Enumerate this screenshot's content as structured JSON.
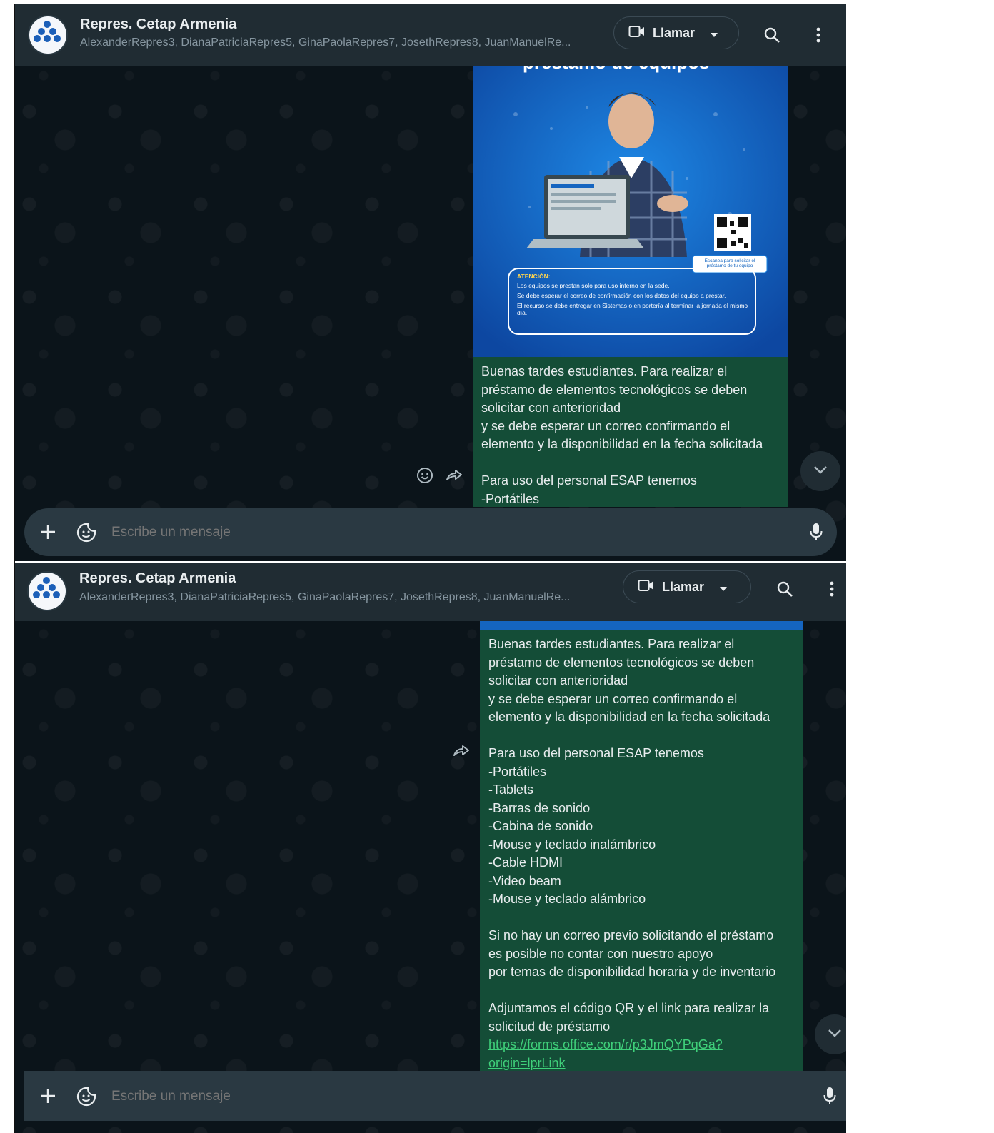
{
  "chat": {
    "title": "Repres. Cetap Armenia",
    "participants": "AlexanderRepres3, DianaPatriciaRepres5, GinaPaolaRepres7, JosethRepres8, JuanManuelRe..."
  },
  "header": {
    "call_label": "Llamar"
  },
  "poster": {
    "heading_fragment": "préstamo de equipos",
    "qr_caption": "Escanea para solicitar el préstamo de tu equipo",
    "attention_title": "ATENCIÓN:",
    "attention_items": [
      "Los equipos se prestan solo para uso interno en la sede.",
      "Se debe esperar el correo de confirmación con los datos del equipo a prestar.",
      "El recurso se debe entregar en Sistemas o en portería al terminar la jornada el mismo día."
    ]
  },
  "message": {
    "lines": [
      "Buenas tardes estudiantes. Para realizar el",
      "préstamo de elementos tecnológicos se deben",
      "solicitar con anterioridad",
      "y se debe esperar un correo confirmando el",
      "elemento y la disponibilidad en la fecha solicitada",
      "",
      "Para uso del personal ESAP tenemos",
      "-Portátiles",
      "-Tablets",
      "-Barras de sonido",
      "-Cabina de sonido",
      "-Mouse y teclado inalámbrico",
      "-Cable HDMI",
      "-Video beam",
      "-Mouse y teclado alámbrico",
      "",
      "Si no hay un correo previo solicitando el préstamo",
      "es posible no contar con nuestro apoyo",
      "por temas de disponibilidad horaria y de inventario",
      "",
      "Adjuntamos el código QR y el link para realizar la",
      "solicitud de préstamo"
    ],
    "link_line1": "https://forms.office.com/r/p3JmQYPqGa?",
    "link_line2": "origin=lprLink"
  },
  "composer": {
    "placeholder": "Escribe un mensaje"
  },
  "icons": {
    "plus": "plus-icon",
    "sticker": "sticker-icon",
    "mic": "microphone-icon",
    "search": "search-icon",
    "menu": "more-vertical-icon",
    "video": "video-camera-icon",
    "chevron": "chevron-down-icon",
    "forward": "forward-icon",
    "emoji": "emoji-icon"
  },
  "colors": {
    "header_bg": "#202c33",
    "bubble_bg": "#144d37",
    "link": "#3fd07a",
    "chat_bg": "#0b141a"
  }
}
